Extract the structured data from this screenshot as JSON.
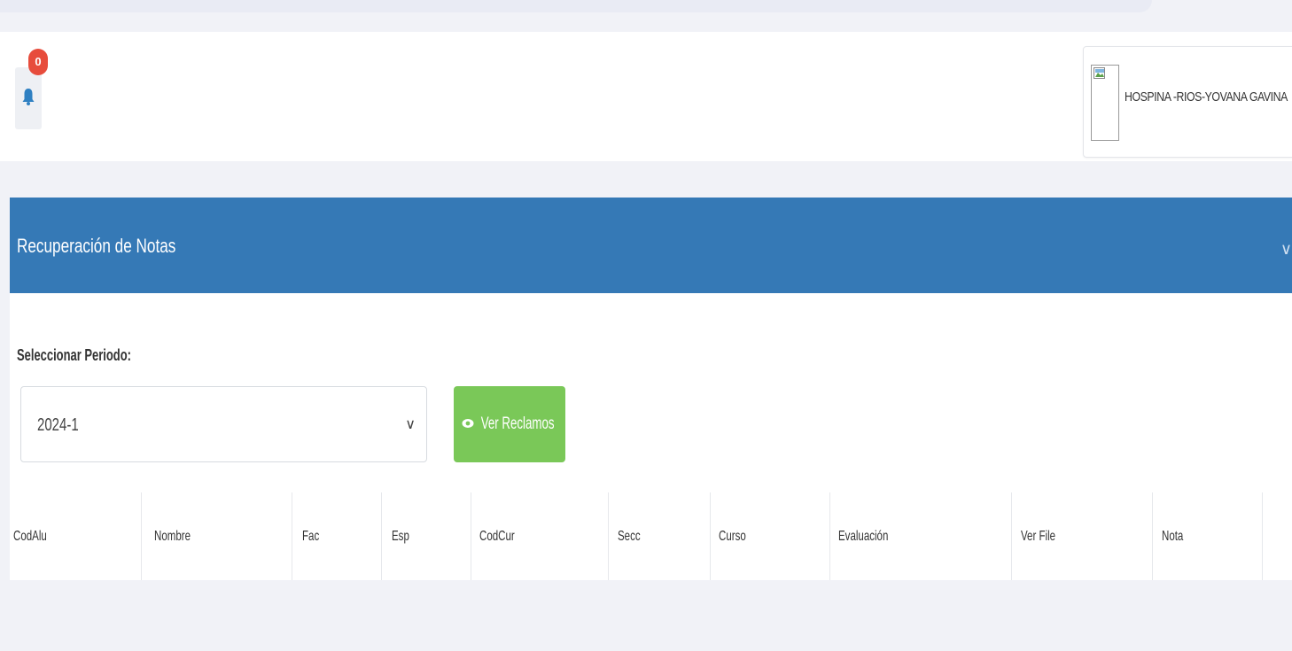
{
  "notifications": {
    "count": "0",
    "icon": "bell-icon"
  },
  "user": {
    "name": "HOSPINA -RIOS-YOVANA GAVINA",
    "avatar_icon": "broken-image-icon"
  },
  "panel": {
    "title": "Recuperación de Notas",
    "collapse_icon": "chevron-down-icon"
  },
  "filter": {
    "label": "Seleccionar Periodo:",
    "selected": "2024-1",
    "button_label": "Ver Reclamos",
    "button_icon": "eye-icon"
  },
  "table": {
    "columns": [
      "CodAlu",
      "Nombre",
      "Fac",
      "Esp",
      "CodCur",
      "Secc",
      "Curso",
      "Evaluación",
      "Ver File",
      "Nota"
    ]
  },
  "colors": {
    "panel_header": "#3579b6",
    "button_green": "#7ac858",
    "badge_red": "#e74c3c",
    "background": "#f1f2f7"
  }
}
